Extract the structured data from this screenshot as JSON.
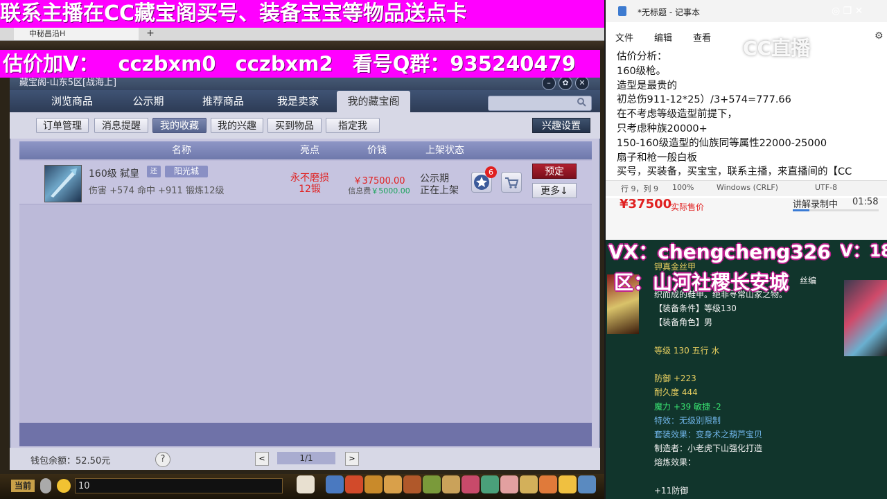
{
  "overlay": {
    "top_banner": "联系主播在CC藏宝阁买号、装备宝宝等物品送点卡",
    "price_banner": [
      "估价加V：",
      "cczbxm0",
      "cczbxm2",
      "看号Q群：",
      "935240479"
    ],
    "vx": "VX：chengcheng326",
    "vx_right": "V：18",
    "server": "区：山河社稷长安城"
  },
  "browser": {
    "tab_label": "中秘昌沿H",
    "add_tab": "+"
  },
  "window": {
    "title": "藏宝阁-山东5区[战海上]",
    "tabs": [
      "浏览商品",
      "公示期",
      "推荐商品",
      "我是卖家",
      "我的藏宝阁"
    ],
    "active_tab": "我的藏宝阁",
    "search_placeholder": "",
    "sub_buttons": [
      "订单管理",
      "消息提醒",
      "我的收藏",
      "我的兴趣",
      "买到物品",
      "指定我"
    ],
    "active_sub": "我的收藏",
    "interest_settings": "兴趣设置",
    "columns": [
      "名称",
      "亮点",
      "价钱",
      "上架状态"
    ],
    "item": {
      "name": "160级 弑皇",
      "tag1": "还",
      "tag2": "阳光城",
      "stats": "伤害 +574 命中 +911 锻炼12级",
      "highlight1": "永不磨损",
      "highlight2": "12锻",
      "price": "￥37500.00",
      "fee_label": "信息费",
      "fee_value": "￥5000.00",
      "status1": "公示期",
      "status2": "正在上架",
      "fav_count": "6",
      "reserve": "预定",
      "more": "更多↓"
    },
    "wallet": "钱包余额：52.50元",
    "help": "?",
    "prev": "<",
    "page": "1/1",
    "next": ">"
  },
  "gamebar": {
    "channel": "当前",
    "chat_value": "10"
  },
  "notepad": {
    "title": "*无标题 - 记事本",
    "menu": [
      "文件",
      "编辑",
      "查看"
    ],
    "text": "估价分析：\n160级枪。\n造型是最贵的\n初总伤911-12*25）/3+574=777.66\n在不考虑等级造型前提下，\n只考虑种族20000+\n150-160级造型的仙族同等属性22000-25000\n扇子和枪一般白板\n买号，买装备，买宝宝，联系主播，来直播间的【CC",
    "status": [
      "行 9，列 9",
      "100%",
      "Windows (CRLF)",
      "UTF-8"
    ],
    "watermark": "CC直播"
  },
  "live": {
    "price": "¥37500",
    "price_sub": "实际售价",
    "label": "讲解录制中",
    "time": "01:58",
    "progress": 0.19
  },
  "detail": {
    "top": "钾真金丝甲",
    "desc_right": "丝编",
    "desc2": "织而成的鞋甲。绝非寻常山家之物。",
    "lines": [
      {
        "text": "【装备条件】等级130",
        "c": "w"
      },
      {
        "text": "【装备角色】男",
        "c": "w"
      },
      {
        "text": "等级 130 五行 水",
        "c": "y"
      },
      {
        "text": "防御 +223",
        "c": "y"
      },
      {
        "text": "耐久度 444",
        "c": "y"
      },
      {
        "text": "魔力 +39 敏捷 -2",
        "c": "gr"
      },
      {
        "text": "特效：无级别限制",
        "c": "bl"
      },
      {
        "text": "套装效果：变身术之葫芦宝贝",
        "c": "bl"
      },
      {
        "text": "制造者：小老虎下山强化打造",
        "c": "w"
      },
      {
        "text": "熔炼效果：",
        "c": "w"
      },
      {
        "text": "+11防御",
        "c": "w"
      }
    ]
  }
}
